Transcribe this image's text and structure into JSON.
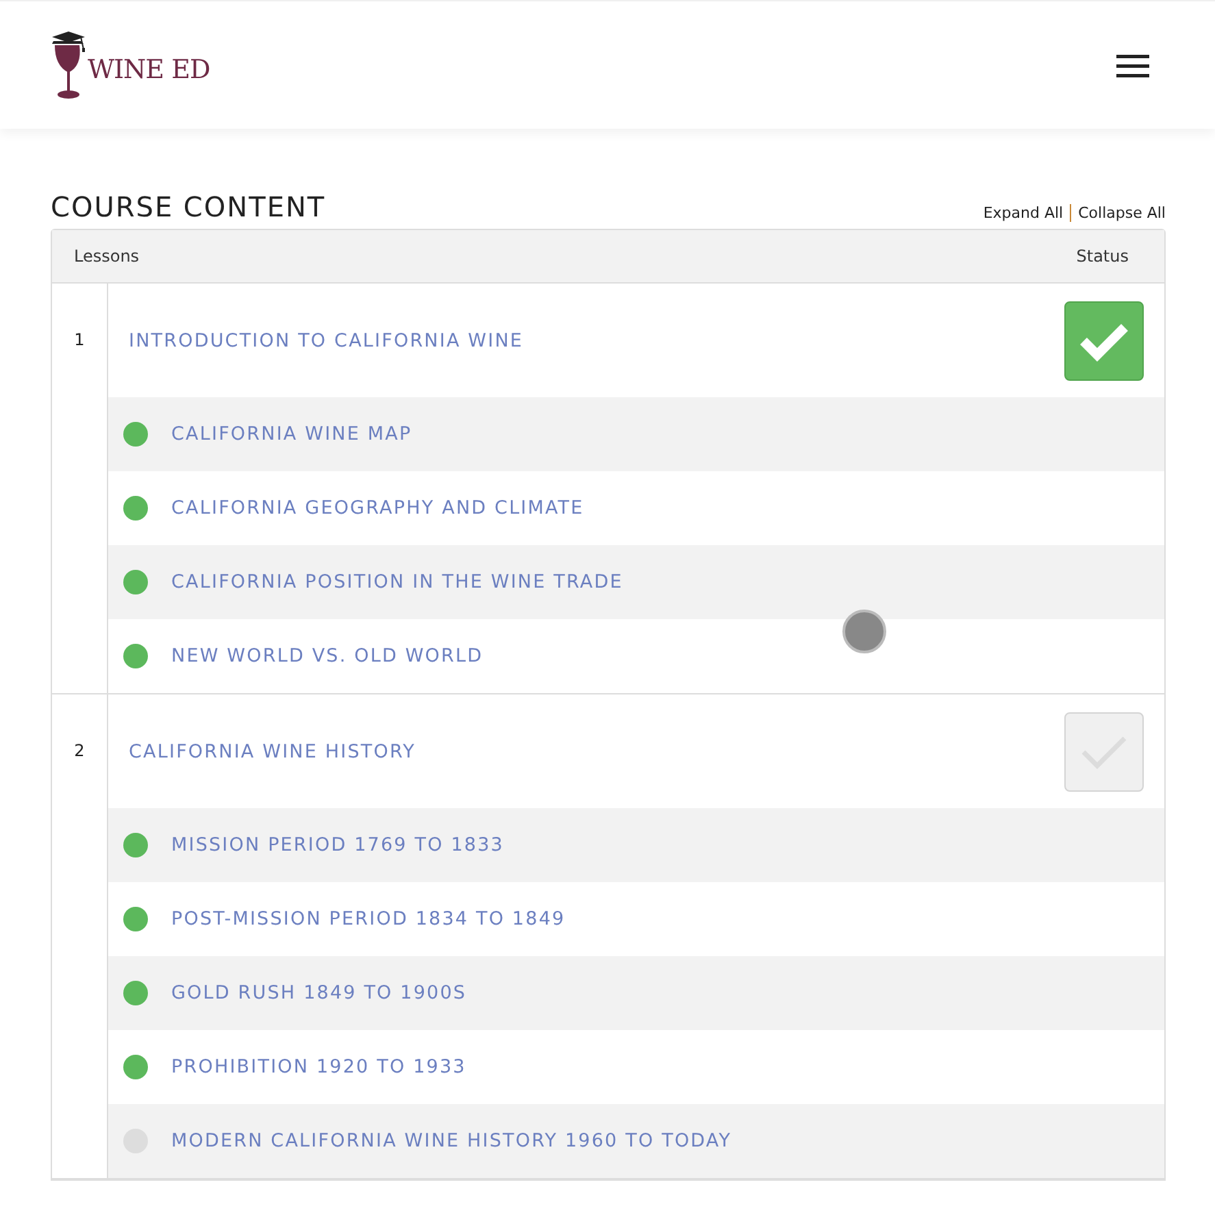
{
  "header": {
    "logo_text": "WINE ED"
  },
  "course": {
    "title": "COURSE CONTENT",
    "expand_all": "Expand All",
    "collapse_all": "Collapse All",
    "columns": {
      "lessons": "Lessons",
      "status": "Status"
    },
    "lessons": [
      {
        "number": "1",
        "title": "INTRODUCTION TO CALIFORNIA WINE",
        "completed": true,
        "topics": [
          {
            "title": "CALIFORNIA WINE MAP",
            "completed": true
          },
          {
            "title": "CALIFORNIA GEOGRAPHY AND CLIMATE",
            "completed": true
          },
          {
            "title": "CALIFORNIA POSITION IN THE WINE TRADE",
            "completed": true
          },
          {
            "title": "NEW WORLD VS. OLD WORLD",
            "completed": true
          }
        ]
      },
      {
        "number": "2",
        "title": "CALIFORNIA WINE HISTORY",
        "completed": false,
        "topics": [
          {
            "title": "MISSION PERIOD 1769 TO 1833",
            "completed": true
          },
          {
            "title": "POST-MISSION PERIOD 1834 TO 1849",
            "completed": true
          },
          {
            "title": "GOLD RUSH 1849 TO 1900S",
            "completed": true
          },
          {
            "title": "PROHIBITION 1920 TO 1933",
            "completed": true
          },
          {
            "title": "MODERN CALIFORNIA WINE HISTORY 1960 TO TODAY",
            "completed": false
          }
        ]
      }
    ]
  }
}
